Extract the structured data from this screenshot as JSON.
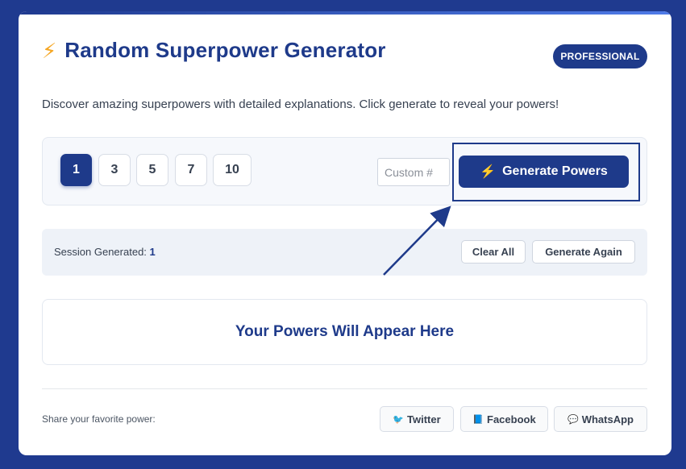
{
  "header": {
    "title": "Random Superpower Generator",
    "badge": "PROFESSIONAL",
    "description": "Discover amazing superpowers with detailed explanations. Click generate to reveal your powers!"
  },
  "controls": {
    "counts": [
      "1",
      "3",
      "5",
      "7",
      "10"
    ],
    "active_count": "1",
    "custom_placeholder": "Custom #",
    "generate_label": "Generate Powers",
    "generate_icon": "lightning-icon"
  },
  "session": {
    "label": "Session Generated:",
    "value": "1",
    "clear_label": "Clear All",
    "again_label": "Generate Again"
  },
  "powers": {
    "placeholder_title": "Your Powers Will Appear Here"
  },
  "share": {
    "label": "Share your favorite power:",
    "buttons": [
      {
        "label": "Twitter",
        "icon": "bird-icon"
      },
      {
        "label": "Facebook",
        "icon": "book-icon"
      },
      {
        "label": "WhatsApp",
        "icon": "speech-bubble-icon"
      }
    ]
  },
  "colors": {
    "background": "#1f3a8f",
    "primary": "#1e3a8a",
    "accent": "#f5a623"
  }
}
